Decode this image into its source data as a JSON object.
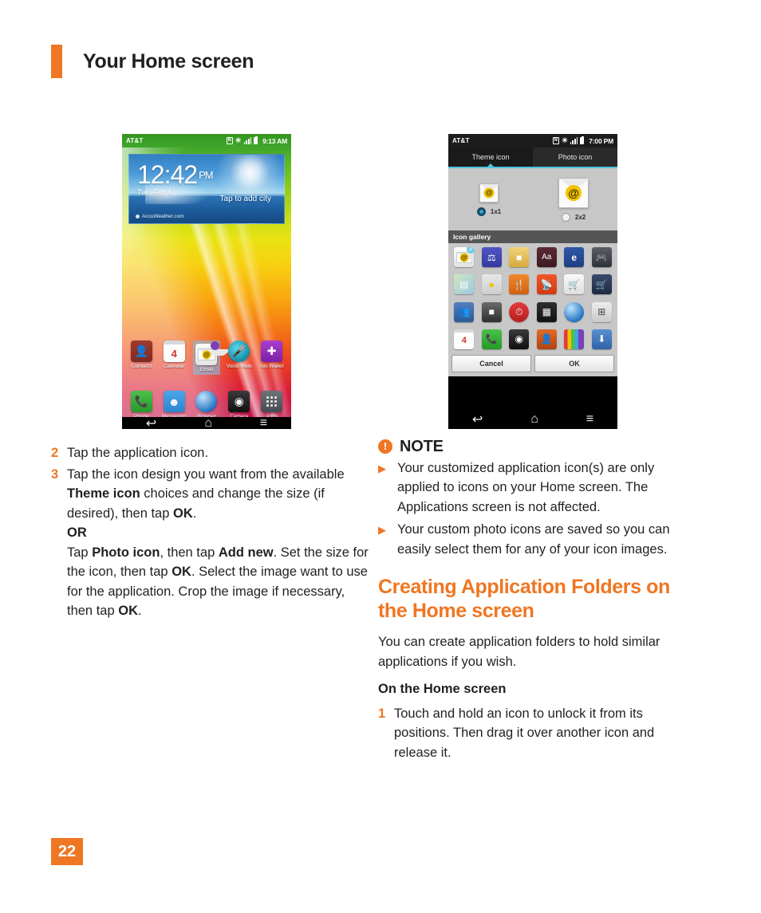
{
  "header": {
    "title": "Your Home screen",
    "accent_color": "#ef7622"
  },
  "phone_left": {
    "status": {
      "carrier": "AT&T",
      "time": "9:13 AM",
      "nfc": "N"
    },
    "widget": {
      "time": "12:42",
      "ampm": "PM",
      "date": "Tue, Feb 4",
      "add_city": "Tap to add city",
      "brand": "AccuWeather.com"
    },
    "apps_main": [
      {
        "label": "Contacts",
        "icon": "contacts-icon"
      },
      {
        "label": "Calendar",
        "icon": "calendar-icon",
        "badge": "4"
      },
      {
        "label": "Email",
        "icon": "email-icon",
        "selected": true
      },
      {
        "label": "Voice Mate",
        "icon": "microphone-icon"
      },
      {
        "label": "Isis Wallet",
        "icon": "wallet-icon"
      }
    ],
    "apps_dock": [
      {
        "label": "Phone",
        "icon": "phone-icon"
      },
      {
        "label": "Messaging",
        "icon": "message-icon"
      },
      {
        "label": "Browser",
        "icon": "globe-icon"
      },
      {
        "label": "Camera",
        "icon": "camera-icon"
      },
      {
        "label": "Apps",
        "icon": "grid-icon"
      }
    ],
    "nav": {
      "back": "↩",
      "home": "⌂",
      "menu": "≡"
    }
  },
  "phone_right": {
    "status": {
      "carrier": "AT&T",
      "time": "7:00 PM",
      "nfc": "N"
    },
    "tabs": [
      {
        "label": "Theme icon",
        "active": true
      },
      {
        "label": "Photo icon",
        "active": false
      }
    ],
    "sizes": [
      {
        "label": "1x1",
        "selected": true
      },
      {
        "label": "2x2",
        "selected": false
      }
    ],
    "gallery_title": "Icon gallery",
    "gallery_icons": [
      {
        "name": "email-icon",
        "selected": true
      },
      {
        "name": "fitness-icon"
      },
      {
        "name": "notes-icon"
      },
      {
        "name": "dictionary-icon"
      },
      {
        "name": "ebook-icon"
      },
      {
        "name": "game-controller-icon"
      },
      {
        "name": "maps-icon"
      },
      {
        "name": "chat-icon"
      },
      {
        "name": "restaurant-icon"
      },
      {
        "name": "rss-icon"
      },
      {
        "name": "shopping-search-icon"
      },
      {
        "name": "cart-icon"
      },
      {
        "name": "social-icon"
      },
      {
        "name": "news-icon"
      },
      {
        "name": "alarm-clock-icon"
      },
      {
        "name": "charts-icon"
      },
      {
        "name": "browser-icon"
      },
      {
        "name": "calculator-icon"
      },
      {
        "name": "calendar-icon"
      },
      {
        "name": "phone-icon"
      },
      {
        "name": "camera-icon"
      },
      {
        "name": "contacts-icon"
      },
      {
        "name": "tv-icon"
      },
      {
        "name": "download-icon"
      }
    ],
    "buttons": {
      "cancel": "Cancel",
      "ok": "OK"
    },
    "nav": {
      "back": "↩",
      "home": "⌂",
      "menu": "≡"
    }
  },
  "left_column": {
    "step2_num": "2",
    "step2_text": "Tap the application icon.",
    "step3_num": "3",
    "step3_a": "Tap the icon design you want from the available ",
    "step3_b1": "Theme icon",
    "step3_c": " choices and change the size (if desired), then tap ",
    "step3_b2": "OK",
    "step3_d": ".",
    "or": "OR",
    "or_a": "Tap ",
    "or_b1": "Photo icon",
    "or_c": ", then tap ",
    "or_b2": "Add new",
    "or_d": ". Set the size for the icon, then tap ",
    "or_b3": "OK",
    "or_e": ". Select the image want to use for the application. Crop the image if necessary, then tap ",
    "or_b4": "OK",
    "or_f": "."
  },
  "right_column": {
    "note_title": "NOTE",
    "note_icon_glyph": "!",
    "note_items": [
      "Your customized application icon(s) are only applied to icons on your Home screen. The Applications screen is not affected.",
      "Your custom photo icons are saved so you can easily select them for any of your icon images."
    ],
    "section_title": "Creating Application Folders on the Home screen",
    "paragraph": "You can create application folders to hold similar applications if you wish.",
    "subhead": "On the Home screen",
    "step1_num": "1",
    "step1_text": "Touch and hold an icon to unlock it from its positions. Then drag it over another icon and release it."
  },
  "footer": {
    "page_number": "22"
  }
}
